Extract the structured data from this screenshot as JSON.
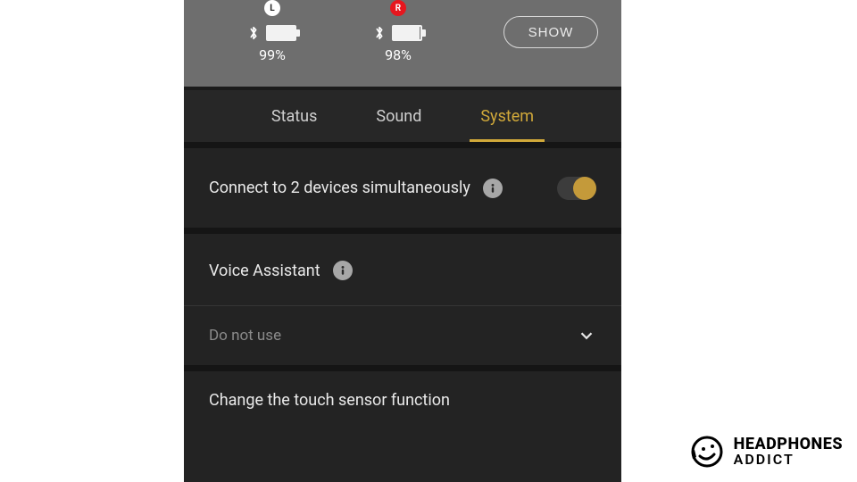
{
  "header": {
    "left": {
      "badge": "L",
      "percent": "99%",
      "fill": 99
    },
    "right": {
      "badge": "R",
      "percent": "98%",
      "fill": 98
    },
    "show_button": "SHOW"
  },
  "tabs": {
    "status": "Status",
    "sound": "Sound",
    "system": "System",
    "active": "system"
  },
  "multipoint": {
    "label": "Connect to 2 devices simultaneously",
    "state": "on"
  },
  "voice_assistant": {
    "label": "Voice Assistant",
    "selected": "Do not use"
  },
  "touch_sensor": {
    "label": "Change the touch sensor function"
  },
  "brand": {
    "line1": "HEADPHONES",
    "line2": "ADDICT"
  },
  "colors": {
    "accent": "#c49a3a"
  }
}
